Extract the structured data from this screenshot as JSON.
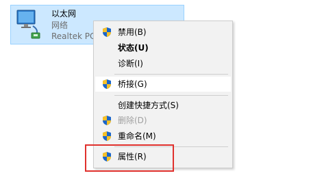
{
  "adapter": {
    "name": "以太网",
    "status": "网络",
    "device": "Realtek PC",
    "icon": "network-adapter-icon"
  },
  "menu": {
    "items": [
      {
        "label": "禁用(B)",
        "shield": true,
        "bold": false,
        "disabled": false
      },
      {
        "label": "状态(U)",
        "shield": false,
        "bold": true,
        "disabled": false
      },
      {
        "label": "诊断(I)",
        "shield": false,
        "bold": false,
        "disabled": false
      },
      {
        "label": "桥接(G)",
        "shield": true,
        "bold": false,
        "disabled": false,
        "highlighted": true
      },
      {
        "label": "创建快捷方式(S)",
        "shield": false,
        "bold": false,
        "disabled": false
      },
      {
        "label": "删除(D)",
        "shield": true,
        "bold": false,
        "disabled": true
      },
      {
        "label": "重命名(M)",
        "shield": true,
        "bold": false,
        "disabled": false
      },
      {
        "label": "属性(R)",
        "shield": true,
        "bold": false,
        "disabled": false
      }
    ]
  },
  "colors": {
    "selection_bg": "#cce8ff",
    "menu_bg": "#f2f2f2",
    "annotation_red": "#e0302c",
    "shield_blue": "#1b66c9",
    "shield_yellow": "#f6c028"
  }
}
